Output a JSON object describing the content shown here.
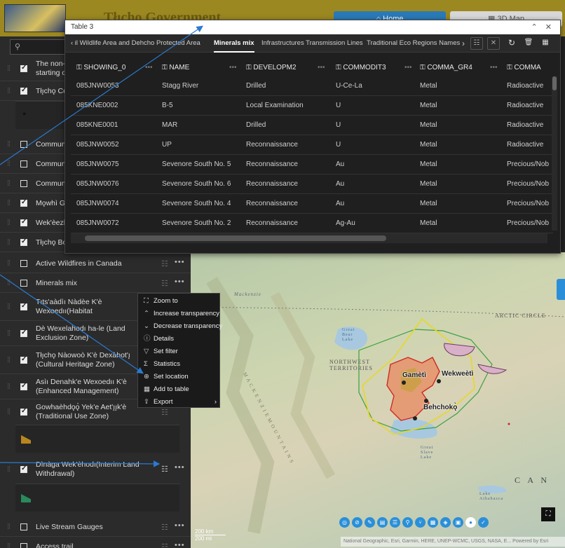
{
  "header": {
    "title": "Tłı̨chǫ Government",
    "tab_home": "⌂  Home",
    "tab_3d": "▦  3D Map"
  },
  "table": {
    "window_title": "Table 3",
    "controls": "⌃ ✕",
    "tabs": [
      "‹  il Wildlife Area and Dehcho Protected Area",
      "Minerals mix",
      "Infrastructures Transmission Lines",
      "Traditional Eco Regions Names",
      "›"
    ],
    "columns": [
      "SHOWING_0",
      "NAME",
      "DEVELOPM2",
      "COMMODIT3",
      "COMMA_GR4",
      "COMMA"
    ],
    "rows": [
      [
        "085JNW0053",
        "Stagg River",
        "Drilled",
        "U-Ce-La",
        "Metal",
        "Radioactive"
      ],
      [
        "085KNE0002",
        "B-5",
        "Local Examination",
        "U",
        "Metal",
        "Radioactive"
      ],
      [
        "085KNE0001",
        "MAR",
        "Drilled",
        "U",
        "Metal",
        "Radioactive"
      ],
      [
        "085JNW0052",
        "UP",
        "Reconnaissance",
        "U",
        "Metal",
        "Radioactive"
      ],
      [
        "085JNW0075",
        "Sevenore South No. 5",
        "Reconnaissance",
        "Au",
        "Metal",
        "Precious/Nob"
      ],
      [
        "085JNW0076",
        "Sevenore South No. 6",
        "Reconnaissance",
        "Au",
        "Metal",
        "Precious/Nob"
      ],
      [
        "085JNW0074",
        "Sevenore South No. 4",
        "Reconnaissance",
        "Au",
        "Metal",
        "Precious/Nob"
      ],
      [
        "085JNW0072",
        "Sevenore South No. 2",
        "Reconnaissance",
        "Ag-Au",
        "Metal",
        "Precious/Nob"
      ]
    ]
  },
  "sidebar": {
    "layers": [
      {
        "label": "The non-hi\nstarting on",
        "checked": true
      },
      {
        "label": "Tłı̨chǫ Con",
        "checked": true
      },
      {
        "label": "Communit",
        "checked": false
      },
      {
        "label": "Communit",
        "checked": false
      },
      {
        "label": "Communit",
        "checked": false
      },
      {
        "label": "Mǫwhì Go",
        "checked": true
      },
      {
        "label": "Wek'èezhì",
        "checked": true
      },
      {
        "label": "Tłı̨chǫ Bou",
        "checked": true
      },
      {
        "label": "Active Wildfires in Canada",
        "checked": false
      },
      {
        "label": "Minerals mix",
        "checked": false
      },
      {
        "label": "Tıts'aàdìı Nàdèe K'è Wexoedıı(Habitat Management Zone)",
        "checked": true
      },
      {
        "label": "Dè Wexelahodı ha-le (Land Exclusion Zone)",
        "checked": true
      },
      {
        "label": "Tłı̨chǫ Nàowoò K'è Dexàhot'ı̨ (Cultural Heritage Zone)",
        "checked": true
      },
      {
        "label": "Asìı Denahk'e Wexoedıı K'è (Enhanced Management)",
        "checked": true
      },
      {
        "label": "Gowhaèhdǫǫ̀ Yek'e Aet'ı̨ı̨k'è (Traditional Use Zone)",
        "checked": true
      },
      {
        "label": "Dìnàga Wek'èhodı(Interim Land Withdrawal)",
        "checked": true
      },
      {
        "label": "Live Stream Gauges",
        "checked": false
      },
      {
        "label": "Access trail",
        "checked": false
      }
    ]
  },
  "context_menu": {
    "items": [
      {
        "icon": "⛶",
        "label": "Zoom to"
      },
      {
        "icon": "⌃",
        "label": "Increase transparency"
      },
      {
        "icon": "⌄",
        "label": "Decrease transparency"
      },
      {
        "icon": "ⓘ",
        "label": "Details"
      },
      {
        "icon": "▽",
        "label": "Set filter"
      },
      {
        "icon": "Σ",
        "label": "Statistics"
      },
      {
        "icon": "⊕",
        "label": "Set location"
      },
      {
        "icon": "▦",
        "label": "Add to table"
      },
      {
        "icon": "⇪",
        "label": "Export"
      }
    ],
    "export_arrow": "›"
  },
  "map": {
    "labels": {
      "arctic_circle": "ARCTIC CIRCLE",
      "northwest_territories": "NORTHWEST\nTERRITORIES",
      "mackenzie": "Mackenzie",
      "canada": "C A N",
      "great_bear_lake": "Great\nBear\nLake",
      "great_slave_lake": "Great\nSlave\nLake",
      "lake_athabasca": "Lake\nAthabasca",
      "mackenzie_mountains": "M A C K E N Z I E   M O U N T A I N S",
      "gameti": "Gamètì",
      "wekweeti": "Wekweètì",
      "behchoko": "Behchokǫ̀"
    },
    "attribution": "National Geographic, Esri, Garmin, HERE, UNEP-WCMC, USGS, NASA, E...   Powered by Esri",
    "scale_km": "200 km",
    "scale_mi": "200 mi"
  },
  "colors": {
    "header_bg": "#9c8820",
    "accent_blue": "#2a8fd8",
    "fire_red": "#e03a2a"
  }
}
